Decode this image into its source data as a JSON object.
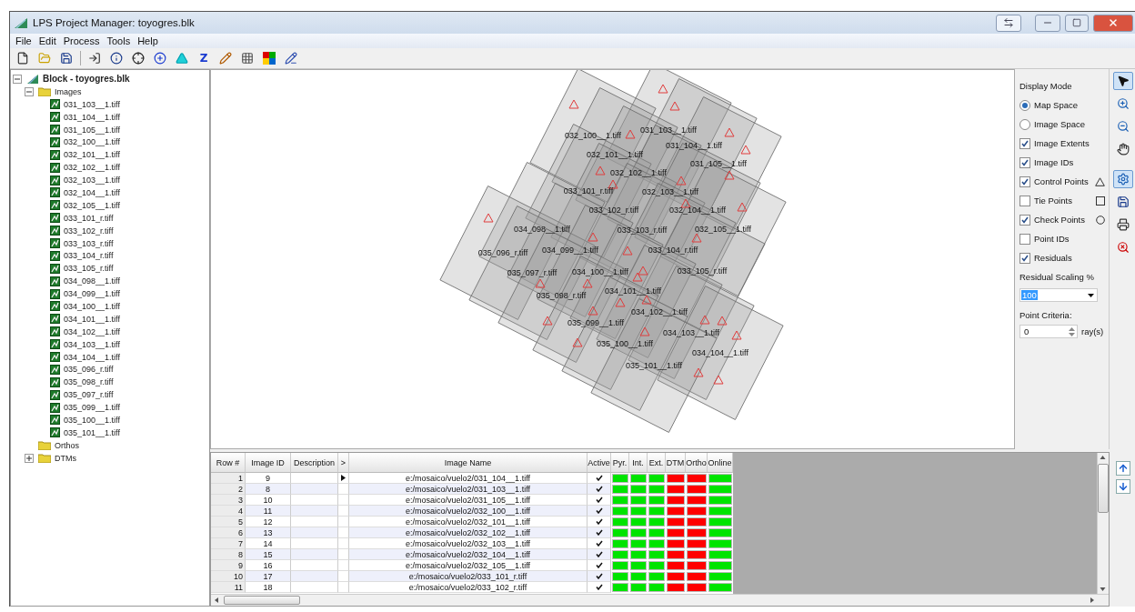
{
  "window": {
    "title": "LPS Project Manager: toyogres.blk"
  },
  "menu": [
    "File",
    "Edit",
    "Process",
    "Tools",
    "Help"
  ],
  "toolbar": [
    {
      "kind": "new"
    },
    {
      "kind": "open"
    },
    {
      "kind": "save"
    },
    {
      "kind": "separator"
    },
    {
      "kind": "add-frame"
    },
    {
      "kind": "info"
    },
    {
      "kind": "target"
    },
    {
      "kind": "crosshair-plus"
    },
    {
      "kind": "triangle"
    },
    {
      "kind": "letter",
      "label": "Z"
    },
    {
      "kind": "pencil"
    },
    {
      "kind": "grid"
    },
    {
      "kind": "color-square"
    },
    {
      "kind": "pencil-check"
    }
  ],
  "tree": {
    "label": "Block - toyogres.blk",
    "kind": "block",
    "expanded": true,
    "children": [
      {
        "label": "Images",
        "kind": "folder",
        "expanded": true,
        "children": [
          {
            "label": "031_103__1.tiff",
            "kind": "image"
          },
          {
            "label": "031_104__1.tiff",
            "kind": "image"
          },
          {
            "label": "031_105__1.tiff",
            "kind": "image"
          },
          {
            "label": "032_100__1.tiff",
            "kind": "image"
          },
          {
            "label": "032_101__1.tiff",
            "kind": "image"
          },
          {
            "label": "032_102__1.tiff",
            "kind": "image"
          },
          {
            "label": "032_103__1.tiff",
            "kind": "image"
          },
          {
            "label": "032_104__1.tiff",
            "kind": "image"
          },
          {
            "label": "032_105__1.tiff",
            "kind": "image"
          },
          {
            "label": "033_101_r.tiff",
            "kind": "image"
          },
          {
            "label": "033_102_r.tiff",
            "kind": "image"
          },
          {
            "label": "033_103_r.tiff",
            "kind": "image"
          },
          {
            "label": "033_104_r.tiff",
            "kind": "image"
          },
          {
            "label": "033_105_r.tiff",
            "kind": "image"
          },
          {
            "label": "034_098__1.tiff",
            "kind": "image"
          },
          {
            "label": "034_099__1.tiff",
            "kind": "image"
          },
          {
            "label": "034_100__1.tiff",
            "kind": "image"
          },
          {
            "label": "034_101__1.tiff",
            "kind": "image"
          },
          {
            "label": "034_102__1.tiff",
            "kind": "image"
          },
          {
            "label": "034_103__1.tiff",
            "kind": "image"
          },
          {
            "label": "034_104__1.tiff",
            "kind": "image"
          },
          {
            "label": "035_096_r.tiff",
            "kind": "image"
          },
          {
            "label": "035_098_r.tiff",
            "kind": "image"
          },
          {
            "label": "035_097_r.tiff",
            "kind": "image"
          },
          {
            "label": "035_099__1.tiff",
            "kind": "image"
          },
          {
            "label": "035_100__1.tiff",
            "kind": "image"
          },
          {
            "label": "035_101__1.tiff",
            "kind": "image"
          }
        ]
      },
      {
        "label": "Orthos",
        "kind": "folder"
      },
      {
        "label": "DTMs",
        "kind": "folder",
        "expanded": false
      }
    ]
  },
  "canvas": {
    "image_labels": [
      "031_103__1.tiff",
      "032_100__1.tiff",
      "031_104__1.tiff",
      "032_101__1.tiff",
      "031_105__1.tiff",
      "032_102__1.tiff",
      "033_101_r.tiff",
      "032_103__1.tiff",
      "033_102_r.tiff",
      "032_104__1.tiff",
      "034_098__1.tiff",
      "033_103_r.tiff",
      "032_105__1.tiff",
      "035_096_r.tiff",
      "034_099__1.tiff",
      "033_104_r.tiff",
      "035_097_r.tiff",
      "034_100__1.tiff",
      "033_105_r.tiff",
      "035_098_r.tiff",
      "034_101__1.tiff",
      "034_102__1.tiff",
      "035_099__1.tiff",
      "034_103__1.tiff",
      "035_100__1.tiff",
      "034_104__1.tiff",
      "035_101__1.tiff"
    ]
  },
  "display_panel": {
    "title": "Display Mode",
    "modes": [
      {
        "label": "Map Space",
        "selected": true
      },
      {
        "label": "Image Space",
        "selected": false
      }
    ],
    "options": [
      {
        "label": "Image Extents",
        "checked": true,
        "kind": "plain"
      },
      {
        "label": "Image IDs",
        "checked": true,
        "kind": "plain"
      },
      {
        "label": "Control Points",
        "checked": true,
        "kind": "triangle"
      },
      {
        "label": "Tie Points",
        "checked": false,
        "kind": "square"
      },
      {
        "label": "Check Points",
        "checked": true,
        "kind": "circle"
      },
      {
        "label": "Point IDs",
        "checked": false,
        "kind": "plain"
      },
      {
        "label": "Residuals",
        "checked": true,
        "kind": "plain"
      }
    ],
    "residual_scaling": {
      "label": "Residual Scaling %",
      "value": "100"
    },
    "point_criteria": {
      "label": "Point Criteria:",
      "value": "0",
      "unit": "ray(s)"
    }
  },
  "tools": [
    {
      "kind": "pointer",
      "selected": true
    },
    {
      "kind": "zoom-in",
      "selected": false
    },
    {
      "kind": "zoom-out",
      "selected": false
    },
    {
      "kind": "pan",
      "selected": false
    },
    {
      "kind": "properties",
      "selected": true
    },
    {
      "kind": "save",
      "selected": false
    },
    {
      "kind": "print",
      "selected": false
    },
    {
      "kind": "zoom-reset",
      "selected": false
    }
  ],
  "table": {
    "columns": [
      "Row #",
      "Image ID",
      "Description",
      ">",
      "Image Name",
      "Active",
      "Pyr.",
      "Int.",
      "Ext.",
      "DTM",
      "Ortho",
      "Online"
    ],
    "rows": [
      {
        "row": "1",
        "image_id": "9",
        "current": true,
        "image_name": "e:/mosaico/vuelo2/031_104__1.tiff",
        "active": true,
        "pyr": true,
        "int": true,
        "ext": true,
        "dtm": false,
        "ortho": false,
        "online": true
      },
      {
        "row": "2",
        "image_id": "8",
        "current": false,
        "image_name": "e:/mosaico/vuelo2/031_103__1.tiff",
        "active": true,
        "pyr": true,
        "int": true,
        "ext": true,
        "dtm": false,
        "ortho": false,
        "online": true
      },
      {
        "row": "3",
        "image_id": "10",
        "current": false,
        "image_name": "e:/mosaico/vuelo2/031_105__1.tiff",
        "active": true,
        "pyr": true,
        "int": true,
        "ext": true,
        "dtm": false,
        "ortho": false,
        "online": true
      },
      {
        "row": "4",
        "image_id": "11",
        "current": false,
        "image_name": "e:/mosaico/vuelo2/032_100__1.tiff",
        "active": true,
        "pyr": true,
        "int": true,
        "ext": true,
        "dtm": false,
        "ortho": false,
        "online": true
      },
      {
        "row": "5",
        "image_id": "12",
        "current": false,
        "image_name": "e:/mosaico/vuelo2/032_101__1.tiff",
        "active": true,
        "pyr": true,
        "int": true,
        "ext": true,
        "dtm": false,
        "ortho": false,
        "online": true
      },
      {
        "row": "6",
        "image_id": "13",
        "current": false,
        "image_name": "e:/mosaico/vuelo2/032_102__1.tiff",
        "active": true,
        "pyr": true,
        "int": true,
        "ext": true,
        "dtm": false,
        "ortho": false,
        "online": true
      },
      {
        "row": "7",
        "image_id": "14",
        "current": false,
        "image_name": "e:/mosaico/vuelo2/032_103__1.tiff",
        "active": true,
        "pyr": true,
        "int": true,
        "ext": true,
        "dtm": false,
        "ortho": false,
        "online": true
      },
      {
        "row": "8",
        "image_id": "15",
        "current": false,
        "image_name": "e:/mosaico/vuelo2/032_104__1.tiff",
        "active": true,
        "pyr": true,
        "int": true,
        "ext": true,
        "dtm": false,
        "ortho": false,
        "online": true
      },
      {
        "row": "9",
        "image_id": "16",
        "current": false,
        "image_name": "e:/mosaico/vuelo2/032_105__1.tiff",
        "active": true,
        "pyr": true,
        "int": true,
        "ext": true,
        "dtm": false,
        "ortho": false,
        "online": true
      },
      {
        "row": "10",
        "image_id": "17",
        "current": false,
        "image_name": "e:/mosaico/vuelo2/033_101_r.tiff",
        "active": true,
        "pyr": true,
        "int": true,
        "ext": true,
        "dtm": false,
        "ortho": false,
        "online": true
      },
      {
        "row": "11",
        "image_id": "18",
        "current": false,
        "image_name": "e:/mosaico/vuelo2/033_102_r.tiff",
        "active": true,
        "pyr": true,
        "int": true,
        "ext": true,
        "dtm": false,
        "ortho": false,
        "online": true
      }
    ]
  }
}
